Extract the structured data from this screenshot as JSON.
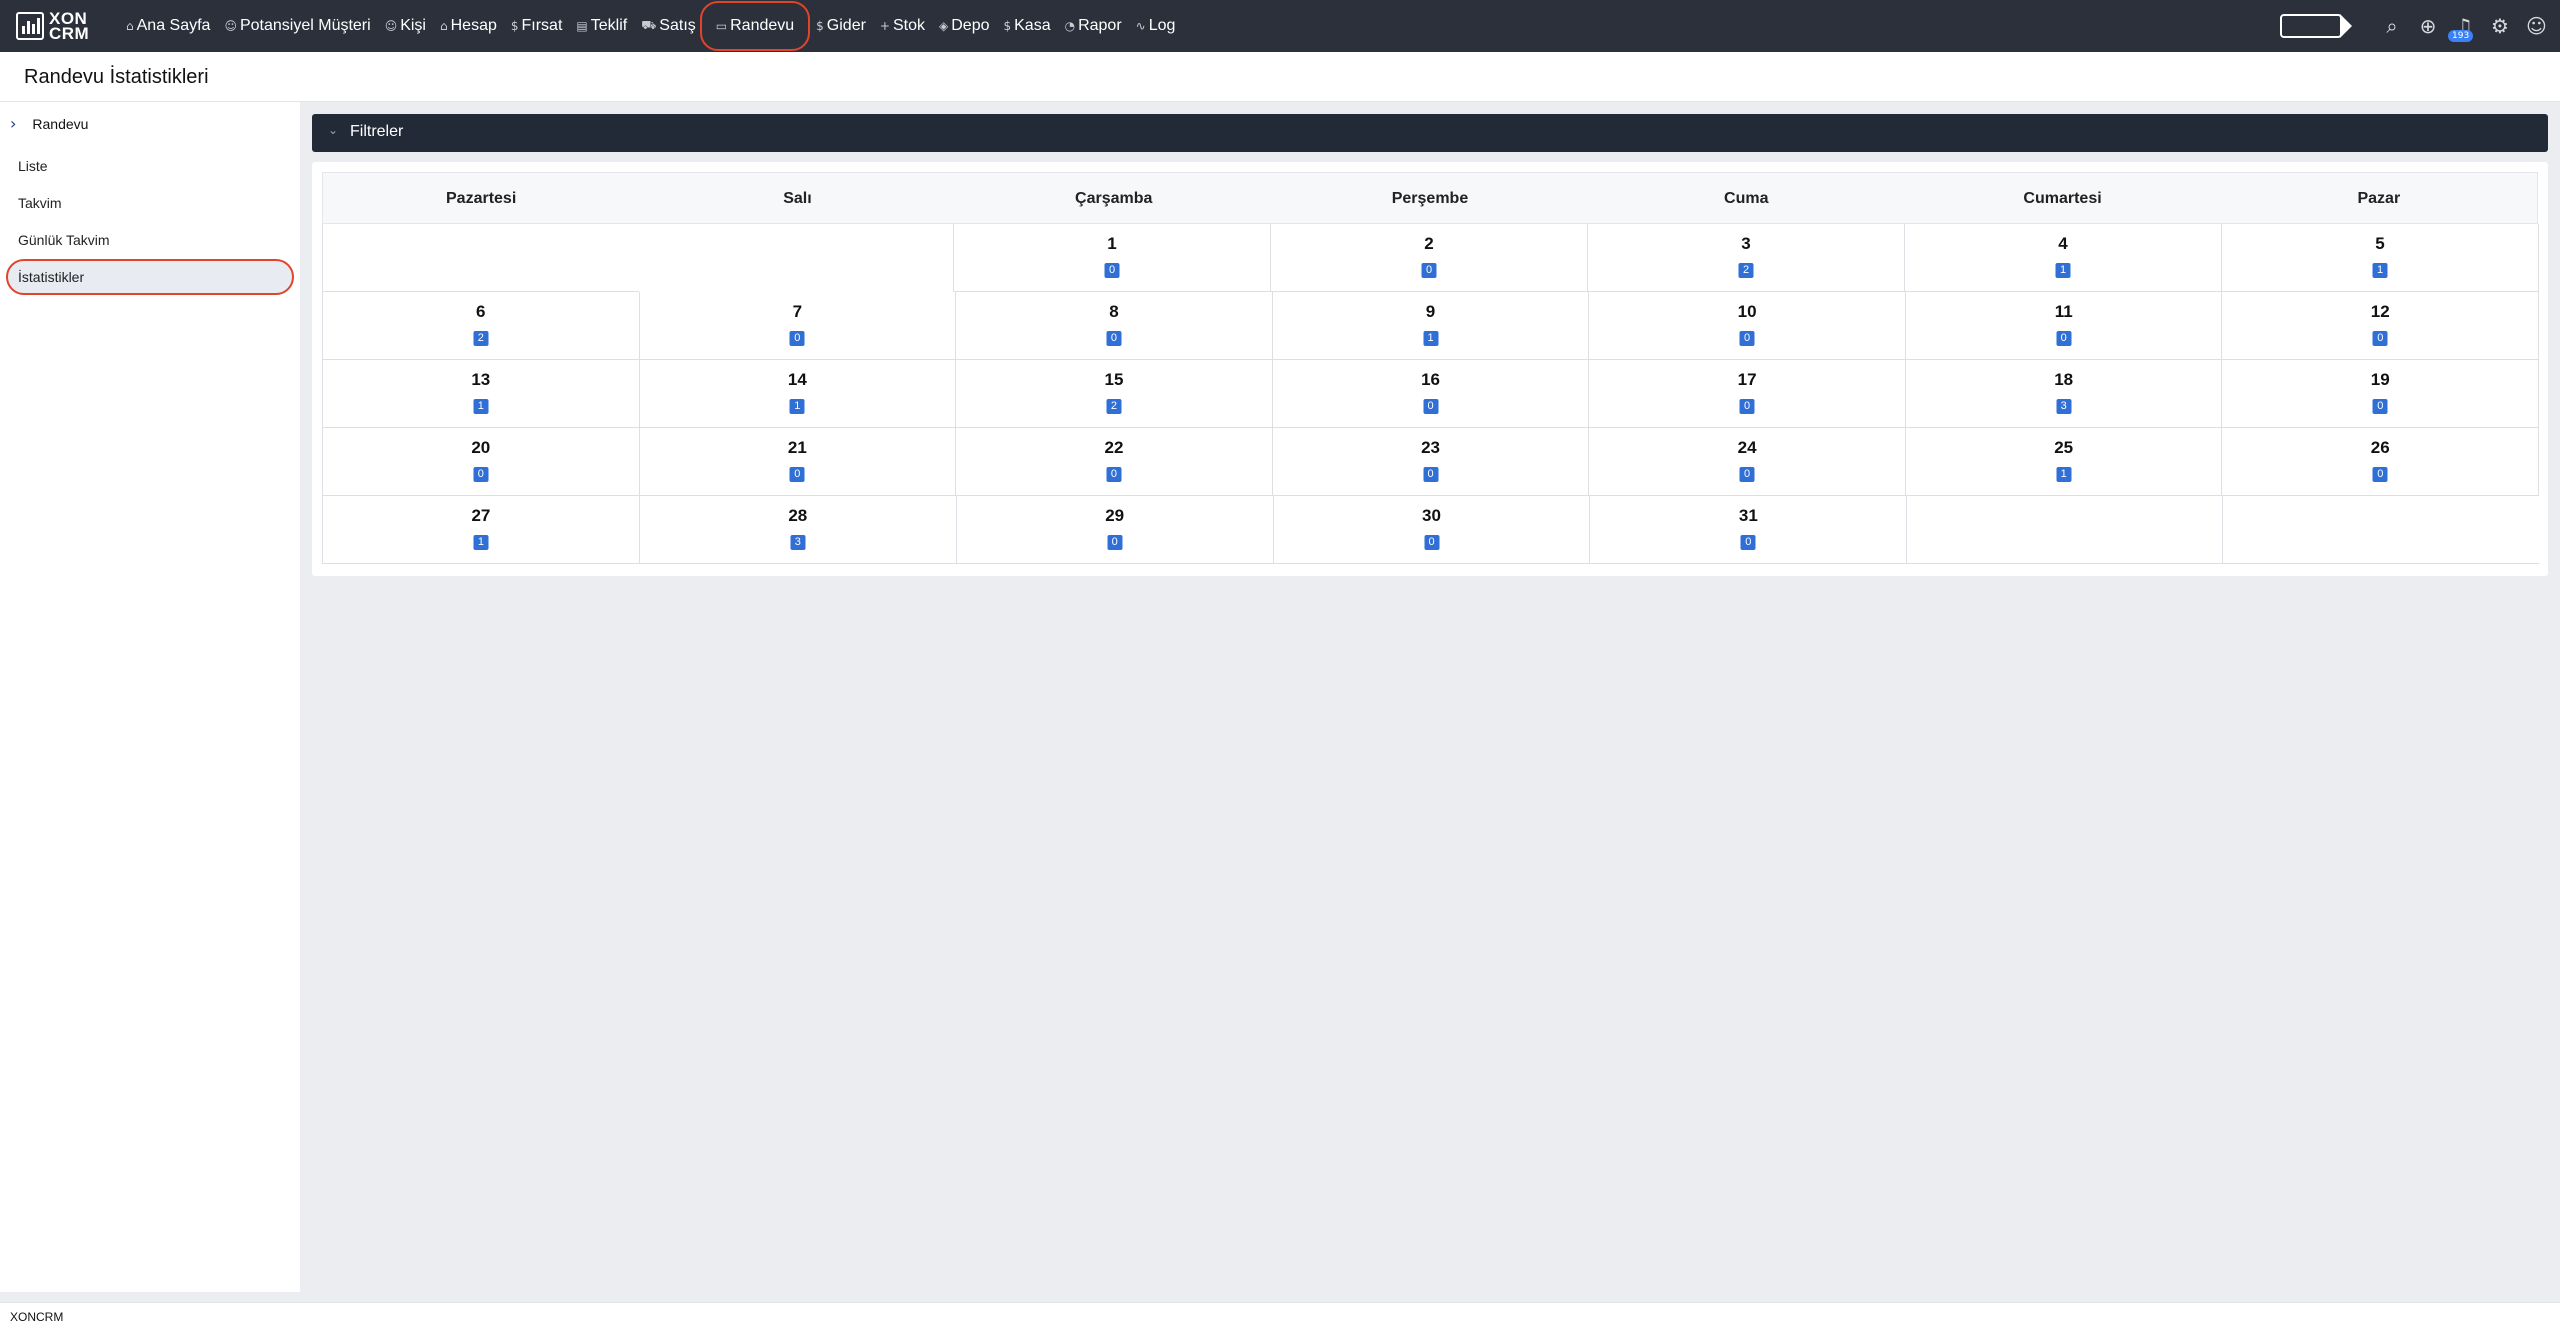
{
  "brand": {
    "line1": "XON",
    "line2": "CRM"
  },
  "nav": [
    {
      "label": "Ana Sayfa",
      "icon": "⌂",
      "name": "nav-ana-sayfa"
    },
    {
      "label": "Potansiyel Müşteri",
      "icon": "☺",
      "name": "nav-potansiyel-musteri"
    },
    {
      "label": "Kişi",
      "icon": "☺",
      "name": "nav-kisi"
    },
    {
      "label": "Hesap",
      "icon": "⌂",
      "name": "nav-hesap"
    },
    {
      "label": "Fırsat",
      "icon": "$",
      "name": "nav-firsat"
    },
    {
      "label": "Teklif",
      "icon": "▤",
      "name": "nav-teklif"
    },
    {
      "label": "Satış",
      "icon": "⛟",
      "name": "nav-satis"
    },
    {
      "label": "Randevu",
      "icon": "▭",
      "name": "nav-randevu",
      "active": true
    },
    {
      "label": "Gider",
      "icon": "$",
      "name": "nav-gider"
    },
    {
      "label": "Stok",
      "icon": "+",
      "name": "nav-stok"
    },
    {
      "label": "Depo",
      "icon": "◈",
      "name": "nav-depo"
    },
    {
      "label": "Kasa",
      "icon": "$",
      "name": "nav-kasa"
    },
    {
      "label": "Rapor",
      "icon": "◔",
      "name": "nav-rapor"
    },
    {
      "label": "Log",
      "icon": "∿",
      "name": "nav-log"
    }
  ],
  "notifications": {
    "count": "193"
  },
  "page": {
    "title": "Randevu İstatistikleri"
  },
  "sidebar": {
    "header": "Randevu",
    "items": [
      {
        "label": "Liste"
      },
      {
        "label": "Takvim"
      },
      {
        "label": "Günlük Takvim"
      },
      {
        "label": "İstatistikler",
        "active": true
      }
    ]
  },
  "filters": {
    "label": "Filtreler"
  },
  "calendar": {
    "weekdays": [
      "Pazartesi",
      "Salı",
      "Çarşamba",
      "Perşembe",
      "Cuma",
      "Cumartesi",
      "Pazar"
    ],
    "leading_empty": 2,
    "days": [
      {
        "day": "1",
        "count": "0"
      },
      {
        "day": "2",
        "count": "0"
      },
      {
        "day": "3",
        "count": "2"
      },
      {
        "day": "4",
        "count": "1"
      },
      {
        "day": "5",
        "count": "1"
      },
      {
        "day": "6",
        "count": "2"
      },
      {
        "day": "7",
        "count": "0"
      },
      {
        "day": "8",
        "count": "0"
      },
      {
        "day": "9",
        "count": "1"
      },
      {
        "day": "10",
        "count": "0"
      },
      {
        "day": "11",
        "count": "0"
      },
      {
        "day": "12",
        "count": "0"
      },
      {
        "day": "13",
        "count": "1"
      },
      {
        "day": "14",
        "count": "1"
      },
      {
        "day": "15",
        "count": "2"
      },
      {
        "day": "16",
        "count": "0"
      },
      {
        "day": "17",
        "count": "0"
      },
      {
        "day": "18",
        "count": "3"
      },
      {
        "day": "19",
        "count": "0"
      },
      {
        "day": "20",
        "count": "0"
      },
      {
        "day": "21",
        "count": "0"
      },
      {
        "day": "22",
        "count": "0"
      },
      {
        "day": "23",
        "count": "0"
      },
      {
        "day": "24",
        "count": "0"
      },
      {
        "day": "25",
        "count": "1"
      },
      {
        "day": "26",
        "count": "0"
      },
      {
        "day": "27",
        "count": "1"
      },
      {
        "day": "28",
        "count": "3"
      },
      {
        "day": "29",
        "count": "0"
      },
      {
        "day": "30",
        "count": "0"
      },
      {
        "day": "31",
        "count": "0"
      }
    ]
  },
  "footer": {
    "text": "XONCRM"
  },
  "colors": {
    "navbar": "#2b303b",
    "highlight": "#e0452c",
    "badge": "#2f6fd6",
    "filter_bar": "#222a38"
  }
}
